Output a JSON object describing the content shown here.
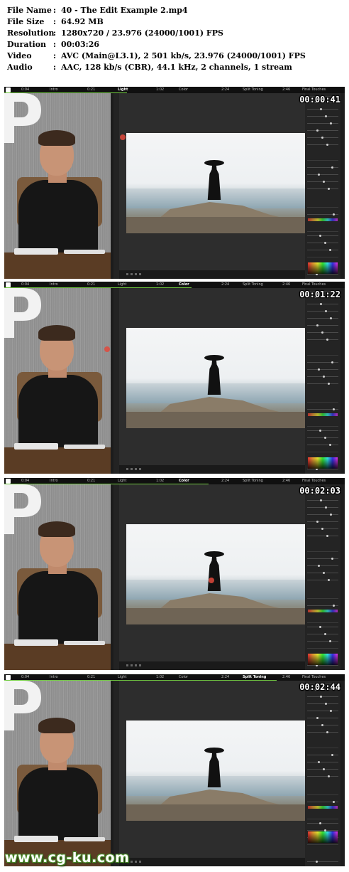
{
  "info": [
    {
      "key": "File Name",
      "sep": ":",
      "value": "40 - The Edit Example 2.mp4"
    },
    {
      "key": "File Size",
      "sep": ":",
      "value": "64.92 MB"
    },
    {
      "key": "Resolution",
      "sep": ":",
      "value": "1280x720 / 23.976 (24000/1001) FPS"
    },
    {
      "key": "Duration",
      "sep": ":",
      "value": "00:03:26"
    },
    {
      "key": "Video",
      "sep": ":",
      "value": "AVC (Main@L3.1), 2 501 kb/s, 23.976 (24000/1001) FPS"
    },
    {
      "key": "Audio",
      "sep": ":",
      "value": "AAC, 128 kb/s (CBR), 44.1 kHz, 2 channels, 1 stream"
    }
  ],
  "chapters": [
    {
      "time": "0:04",
      "label": "Intro"
    },
    {
      "time": "0:21",
      "label": "Light"
    },
    {
      "time": "1:02",
      "label": "Color"
    },
    {
      "time": "2:24",
      "label": "Split Toning"
    },
    {
      "time": "2:46",
      "label": "Final Touches"
    }
  ],
  "frames": [
    {
      "timecode": "00:00:41",
      "active_chapter": 1,
      "progress": 0.36
    },
    {
      "timecode": "00:01:22",
      "active_chapter": 2,
      "progress": 0.55
    },
    {
      "timecode": "00:02:03",
      "active_chapter": 2,
      "progress": 0.6
    },
    {
      "timecode": "00:02:44",
      "active_chapter": 3,
      "progress": 0.8
    }
  ],
  "watermark": "www.cg-ku.com",
  "colors": {
    "progress_green": "#6fc83f",
    "cursor_red": "#e0493c",
    "panel_bg": "#242424",
    "topbar_bg": "#101010"
  }
}
